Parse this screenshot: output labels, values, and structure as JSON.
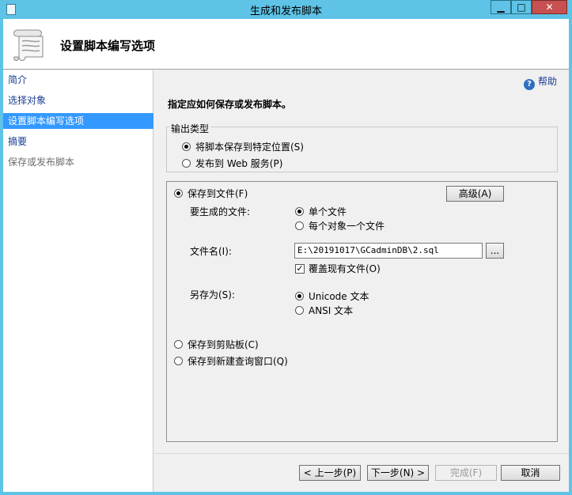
{
  "window": {
    "title": "生成和发布脚本",
    "controls": {
      "minimize": "▁",
      "maximize": "□",
      "close": "✕"
    }
  },
  "header": {
    "title": "设置脚本编写选项",
    "icon": "script-scroll-icon"
  },
  "nav": {
    "items": [
      {
        "label": "简介",
        "state": "normal"
      },
      {
        "label": "选择对象",
        "state": "normal"
      },
      {
        "label": "设置脚本编写选项",
        "state": "selected"
      },
      {
        "label": "摘要",
        "state": "normal"
      },
      {
        "label": "保存或发布脚本",
        "state": "disabled"
      }
    ]
  },
  "help": {
    "label": "帮助",
    "icon": "help-icon",
    "glyph": "?"
  },
  "main": {
    "instruction": "指定应如何保存或发布脚本。",
    "output_type": {
      "legend": "输出类型",
      "options": [
        {
          "label": "将脚本保存到特定位置(S)",
          "selected": true
        },
        {
          "label": "发布到 Web 服务(P)",
          "selected": false
        }
      ]
    },
    "save_to_file": {
      "label": "保存到文件(F)",
      "selected": true
    },
    "advanced_button": "高级(A)",
    "files_to_generate": {
      "label": "要生成的文件:",
      "options": [
        {
          "label": "单个文件",
          "selected": true
        },
        {
          "label": "每个对象一个文件",
          "selected": false
        }
      ]
    },
    "file_name": {
      "label": "文件名(I):",
      "value": "E:\\20191017\\GCadminDB\\2.sql",
      "browse_label": "..."
    },
    "overwrite": {
      "label": "覆盖现有文件(O)",
      "checked": true,
      "check_glyph": "✓"
    },
    "save_as": {
      "label": "另存为(S):",
      "options": [
        {
          "label": "Unicode 文本",
          "selected": true
        },
        {
          "label": "ANSI 文本",
          "selected": false
        }
      ]
    },
    "save_to_clipboard": {
      "label": "保存到剪贴板(C)",
      "selected": false
    },
    "save_to_query_window": {
      "label": "保存到新建查询窗口(Q)",
      "selected": false
    }
  },
  "footer": {
    "prev": "< 上一步(P)",
    "next": "下一步(N) >",
    "finish": "完成(F)",
    "cancel": "取消"
  },
  "colors": {
    "titlebar": "#5ec3e6",
    "selection": "#3399ff",
    "link": "#1a3d8f",
    "close_button": "#c75050"
  }
}
